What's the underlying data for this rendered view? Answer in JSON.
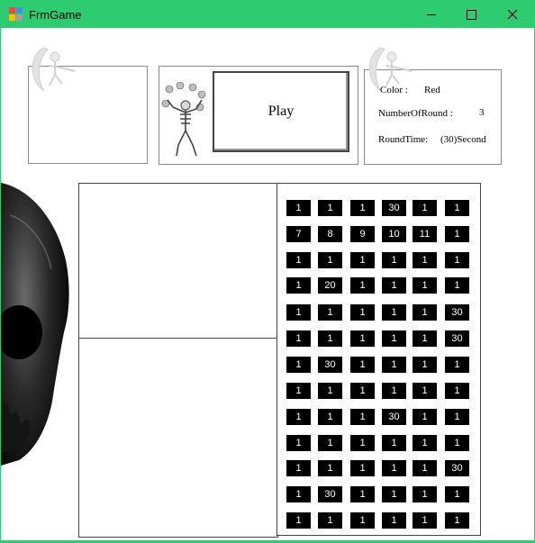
{
  "window": {
    "title": "FrmGame"
  },
  "play_label": "Play",
  "info": {
    "color_label": "Color :",
    "color_value": "Red",
    "rounds_label": "NumberOfRound :",
    "rounds_value": "3",
    "time_label": "RoundTime:",
    "time_value": "(30)Second"
  },
  "grid": [
    [
      "1",
      "1",
      "1",
      "30",
      "1",
      "1"
    ],
    [
      "7",
      "8",
      "9",
      "10",
      "11",
      "1"
    ],
    [
      "1",
      "1",
      "1",
      "1",
      "1",
      "1"
    ],
    [
      "1",
      "20",
      "1",
      "1",
      "1",
      "1"
    ],
    [
      "1",
      "1",
      "1",
      "1",
      "1",
      "30"
    ],
    [
      "1",
      "1",
      "1",
      "1",
      "1",
      "30"
    ],
    [
      "1",
      "30",
      "1",
      "1",
      "1",
      "1"
    ],
    [
      "1",
      "1",
      "1",
      "1",
      "1",
      "1"
    ],
    [
      "1",
      "1",
      "1",
      "30",
      "1",
      "1"
    ],
    [
      "1",
      "1",
      "1",
      "1",
      "1",
      "1"
    ],
    [
      "1",
      "1",
      "1",
      "1",
      "1",
      "30"
    ],
    [
      "1",
      "30",
      "1",
      "1",
      "1",
      "1"
    ],
    [
      "1",
      "1",
      "1",
      "1",
      "1",
      "1"
    ]
  ]
}
